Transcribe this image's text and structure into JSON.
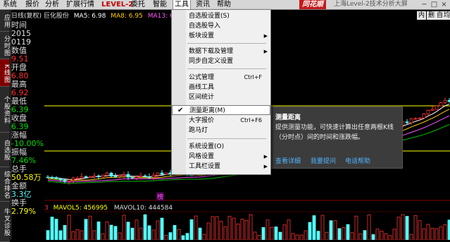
{
  "menubar": {
    "items": [
      "系统",
      "报价",
      "分析",
      "扩展行情",
      "LEVEL-2",
      "委托",
      "智能",
      "工具",
      "资讯",
      "帮助"
    ],
    "brand": "同花顺",
    "title": "上海Level-2技术分析大屏"
  },
  "left_tabs": [
    "应用",
    "分时图",
    "K线图",
    "个股资料",
    "自选股",
    "综合排名",
    "牛叉诊股"
  ],
  "header": {
    "stock": "日线(复权) 巨化股份",
    "ma5": "MA5: 6.98",
    "ma8": "MA8: 6.95",
    "ma13": "MA13: 6"
  },
  "right_tabs": [
    "内",
    "删",
    "自",
    "均"
  ],
  "info": {
    "time_label": "时间",
    "time_year": "2015",
    "time_date": "0119",
    "value_label": "数值",
    "value": "9.51",
    "open_label": "开盘",
    "open": "6.80",
    "high_label": "最高",
    "high": "6.92",
    "low_label": "最低",
    "low": "6.39",
    "close_label": "收盘",
    "close": "6.39",
    "change_label": "涨幅",
    "change": "-10.00%",
    "amp_label": "振幅",
    "amp": "7.46%",
    "vol_label": "总手",
    "vol": "50.58万",
    "amt_label": "金额",
    "amt": "3.3亿",
    "turnover_label": "换手",
    "turnover": "2.79%"
  },
  "volume_header": {
    "vol_prefix": "3",
    "mavol5": "MAVOL5: 456995",
    "mavol10": "MAVOL10: 444584"
  },
  "marker": "榜",
  "dropdown": {
    "items": [
      {
        "label": "自选股设置(S)",
        "shortcut": "",
        "submenu": false
      },
      {
        "label": "自选股导入",
        "shortcut": "",
        "submenu": false
      },
      {
        "label": "板块设置",
        "shortcut": "",
        "submenu": true
      },
      {
        "label": "数据下载及管理",
        "shortcut": "",
        "submenu": true
      },
      {
        "label": "同步自定义设置",
        "shortcut": "",
        "submenu": false
      },
      {
        "label": "公式管理",
        "shortcut": "Ctrl+F",
        "submenu": false
      },
      {
        "label": "画线工具",
        "shortcut": "",
        "submenu": false
      },
      {
        "label": "区间统计",
        "shortcut": "",
        "submenu": false
      },
      {
        "label": "测量距离(M)",
        "shortcut": "",
        "submenu": false,
        "checked": true,
        "highlighted": true
      },
      {
        "label": "大字报价",
        "shortcut": "Ctrl+F6",
        "submenu": false
      },
      {
        "label": "跑马灯",
        "shortcut": "",
        "submenu": false
      },
      {
        "label": "系统设置(O)",
        "shortcut": "",
        "submenu": false
      },
      {
        "label": "风格设置",
        "shortcut": "",
        "submenu": true
      },
      {
        "label": "工具栏设置",
        "shortcut": "",
        "submenu": true
      }
    ]
  },
  "tooltip": {
    "title": "测量距离",
    "desc": "提供测量功能，可快速计算出任意两根K线（分时点）间的时间和涨跌幅。",
    "link1": "查看详细",
    "link2": "我要提问",
    "link3": "电话帮助"
  },
  "colors": {
    "up": "#ff3232",
    "down": "#54ffff",
    "ma5": "#ffffff",
    "ma8": "#ffcc00",
    "ma13": "#ff55ff",
    "green_line": "#00c000",
    "yellow_line": "#ffff00"
  }
}
